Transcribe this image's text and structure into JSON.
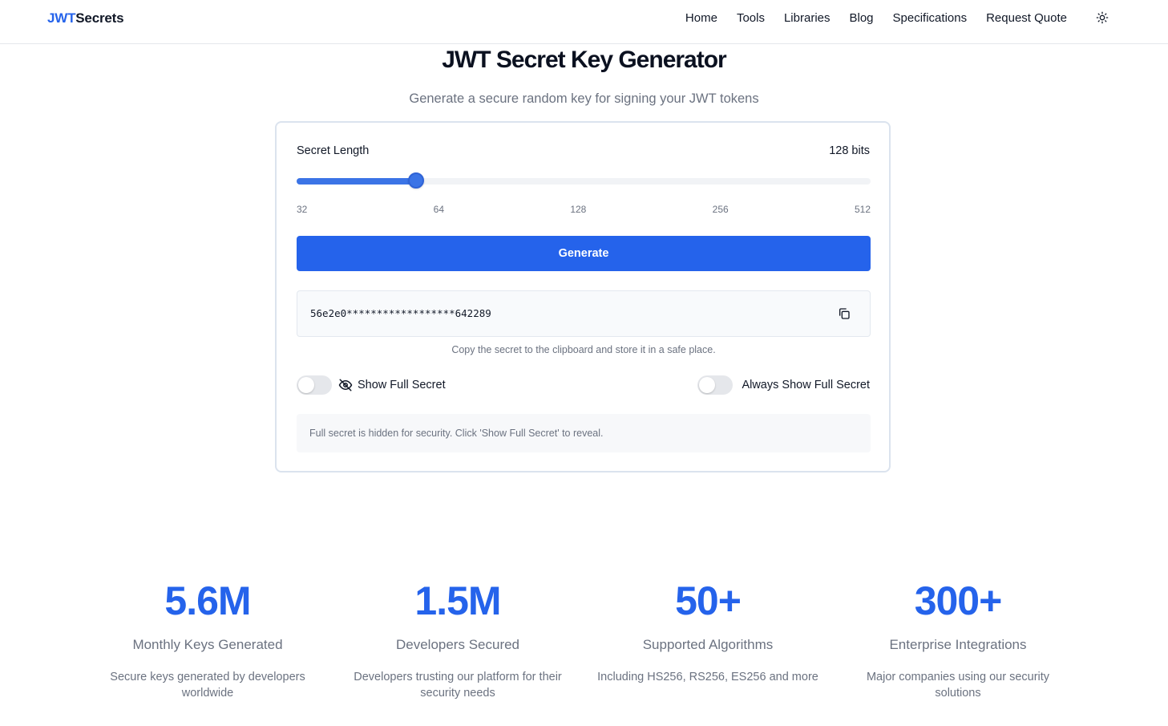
{
  "header": {
    "logo_part1": "JWT",
    "logo_part2": "Secrets",
    "nav": [
      "Home",
      "Tools",
      "Libraries",
      "Blog",
      "Specifications",
      "Request Quote"
    ],
    "theme_icon": "sun-icon"
  },
  "page": {
    "title": "JWT Secret Key Generator",
    "subtitle": "Generate a secure random key for signing your JWT tokens"
  },
  "generator": {
    "length_label": "Secret Length",
    "length_value": "128 bits",
    "slider_fraction": 0.208,
    "ticks": [
      "32",
      "64",
      "128",
      "256",
      "512"
    ],
    "generate_label": "Generate",
    "secret": "56e2e0******************642289",
    "copy_icon": "copy-icon",
    "hint": "Copy the secret to the clipboard and store it in a safe place.",
    "show_full_label": "Show Full Secret",
    "show_full_icon": "eye-off-icon",
    "show_full_on": false,
    "always_show_label": "Always Show Full Secret",
    "always_show_on": false,
    "notice": "Full secret is hidden for security. Click 'Show Full Secret' to reveal."
  },
  "stats": [
    {
      "value": "5.6M",
      "label": "Monthly Keys Generated",
      "desc": "Secure keys generated by developers worldwide"
    },
    {
      "value": "1.5M",
      "label": "Developers Secured",
      "desc": "Developers trusting our platform for their security needs"
    },
    {
      "value": "50+",
      "label": "Supported Algorithms",
      "desc": "Including HS256, RS256, ES256 and more"
    },
    {
      "value": "300+",
      "label": "Enterprise Integrations",
      "desc": "Major companies using our security solutions"
    }
  ],
  "colors": {
    "accent": "#2563eb",
    "slider": "#3b74e6",
    "muted_text": "#6b7280"
  }
}
